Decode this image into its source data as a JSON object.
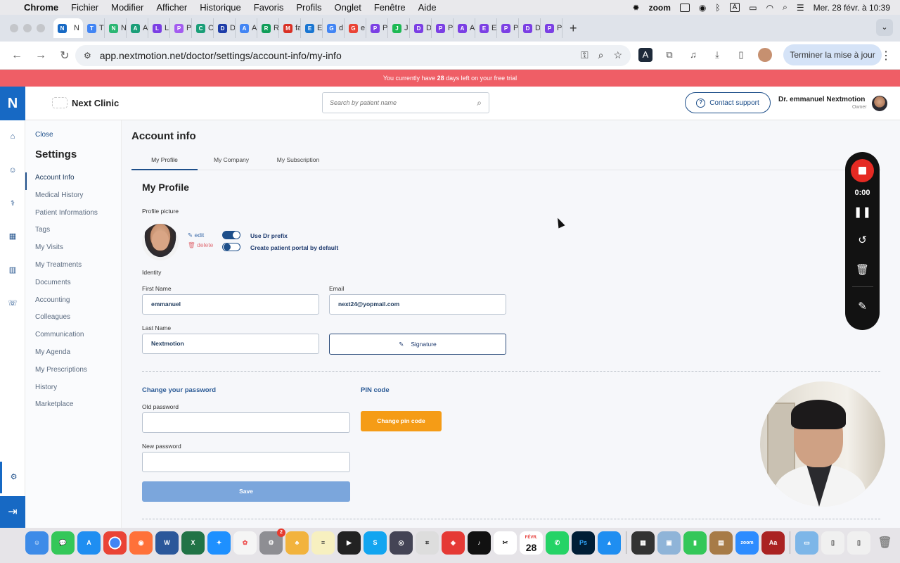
{
  "menubar": {
    "items": [
      "Chrome",
      "Fichier",
      "Modifier",
      "Afficher",
      "Historique",
      "Favoris",
      "Profils",
      "Onglet",
      "Fenêtre",
      "Aide"
    ],
    "zoom_label": "zoom",
    "keyboard_label": "A",
    "datetime": "Mer. 28 févr. à 10:39"
  },
  "browser": {
    "tabs": [
      {
        "letter": "N",
        "color": "#1769c4",
        "title": "N"
      },
      {
        "letter": "T",
        "color": "#4285f4",
        "title": "T"
      },
      {
        "letter": "N",
        "color": "#2bb673",
        "title": "N"
      },
      {
        "letter": "A",
        "color": "#1a9e78",
        "title": "A"
      },
      {
        "letter": "L",
        "color": "#7b3fe4",
        "title": "L"
      },
      {
        "letter": "P",
        "color": "#a35cf0",
        "title": "P"
      },
      {
        "letter": "C",
        "color": "#1a9e78",
        "title": "C"
      },
      {
        "letter": "D",
        "color": "#1d3ca8",
        "title": "D"
      },
      {
        "letter": "A",
        "color": "#4285f4",
        "title": "A"
      },
      {
        "letter": "R",
        "color": "#0f9d58",
        "title": "R"
      },
      {
        "letter": "M",
        "color": "#d93025",
        "title": "fa"
      },
      {
        "letter": "E",
        "color": "#1976d2",
        "title": "E"
      },
      {
        "letter": "G",
        "color": "#4285f4",
        "title": "d"
      },
      {
        "letter": "G",
        "color": "#ea4335",
        "title": "e"
      },
      {
        "letter": "P",
        "color": "#7b3fe4",
        "title": "P"
      },
      {
        "letter": "J",
        "color": "#1db954",
        "title": "J"
      },
      {
        "letter": "D",
        "color": "#7b3fe4",
        "title": "D"
      },
      {
        "letter": "P",
        "color": "#7b3fe4",
        "title": "P"
      },
      {
        "letter": "A",
        "color": "#7b3fe4",
        "title": "A"
      },
      {
        "letter": "E",
        "color": "#7b3fe4",
        "title": "E"
      },
      {
        "letter": "P",
        "color": "#7b3fe4",
        "title": "P"
      },
      {
        "letter": "D",
        "color": "#7b3fe4",
        "title": "D"
      },
      {
        "letter": "P",
        "color": "#7b3fe4",
        "title": "P"
      }
    ],
    "url": "app.nextmotion.net/doctor/settings/account-info/my-info",
    "update_button": "Terminer la mise à jour"
  },
  "trial_banner": {
    "prefix": "You currently have ",
    "days": "28",
    "suffix": " days left on your free trial"
  },
  "header": {
    "logo_letter": "N",
    "clinic_name": "Next Clinic",
    "search_placeholder": "Search by patient name",
    "contact_label": "Contact support",
    "user_name": "Dr. emmanuel Nextmotion",
    "user_role": "Owner"
  },
  "settings": {
    "close_label": "Close",
    "title": "Settings",
    "nav": [
      "Account Info",
      "Medical History",
      "Patient Informations",
      "Tags",
      "My Visits",
      "My Treatments",
      "Documents",
      "Accounting",
      "Colleagues",
      "Communication",
      "My Agenda",
      "My Prescriptions",
      "History",
      "Marketplace"
    ]
  },
  "account": {
    "title": "Account info",
    "tabs": [
      "My Profile",
      "My Company",
      "My Subscription"
    ],
    "section_title": "My Profile",
    "profile_picture_label": "Profile picture",
    "edit_label": "edit",
    "delete_label": "delete",
    "toggle_dr_prefix": "Use Dr prefix",
    "toggle_portal": "Create patient portal by default",
    "identity_label": "Identity",
    "first_name_label": "First Name",
    "first_name_value": "emmanuel",
    "email_label": "Email",
    "email_value": "next24@yopmail.com",
    "last_name_label": "Last Name",
    "last_name_value": "Nextmotion",
    "signature_label": "Signature",
    "change_password_title": "Change your password",
    "old_password_label": "Old password",
    "new_password_label": "New password",
    "save_label": "Save",
    "pin_title": "PIN code",
    "pin_button": "Change pin code"
  },
  "recorder": {
    "time": "0:00"
  },
  "dock": {
    "calendar_month": "FÉVR.",
    "calendar_day": "28",
    "mail_badge": "2",
    "zoom_label": "zoom"
  }
}
